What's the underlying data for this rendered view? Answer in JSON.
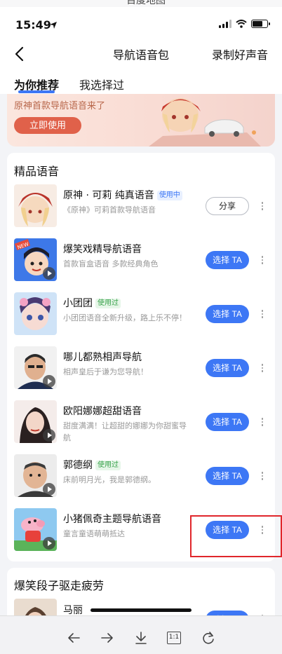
{
  "status": {
    "time": "15:49"
  },
  "nav": {
    "title": "导航语音包",
    "right": "录制好声音"
  },
  "tabs": [
    {
      "label": "为你推荐"
    },
    {
      "label": "我选择过"
    }
  ],
  "banner": {
    "text": "原神首款导航语音来了",
    "button": "立即使用"
  },
  "section1": {
    "title": "精品语音",
    "items": [
      {
        "name": "原神 · 可莉 纯真语音",
        "badge": "使用中",
        "desc": "《原神》可莉首款导航语音",
        "action": "分享"
      },
      {
        "name": "爆笑戏精导航语音",
        "badge": "",
        "desc": "首款盲盒语音 多款经典角色",
        "action": "选择 TA"
      },
      {
        "name": "小团团",
        "badge": "使用过",
        "desc": "小团团语音全新升级，路上乐不停！",
        "action": "选择 TA"
      },
      {
        "name": "哪儿都熟相声导航",
        "badge": "",
        "desc": "相声皇后于谦为您导航！",
        "action": "选择 TA"
      },
      {
        "name": "欧阳娜娜超甜语音",
        "badge": "",
        "desc": "甜度满满！让超甜的娜娜为你甜蜜导航",
        "action": "选择 TA"
      },
      {
        "name": "郭德纲",
        "badge": "使用过",
        "desc": "床前明月光，我是郭德纲。",
        "action": "选择 TA"
      },
      {
        "name": "小猪佩奇主题导航语音",
        "badge": "",
        "desc": "童言童语萌萌抵达",
        "action": "选择 TA"
      }
    ]
  },
  "section2": {
    "title": "爆笑段子驱走疲劳",
    "items": [
      {
        "name": "马丽",
        "action": "选择 TA"
      }
    ]
  },
  "toolbar": {
    "zoom_label": "1:1"
  },
  "colors": {
    "accent": "#3d77f5",
    "banner_button": "#e0614a",
    "highlight": "#e0262b"
  }
}
